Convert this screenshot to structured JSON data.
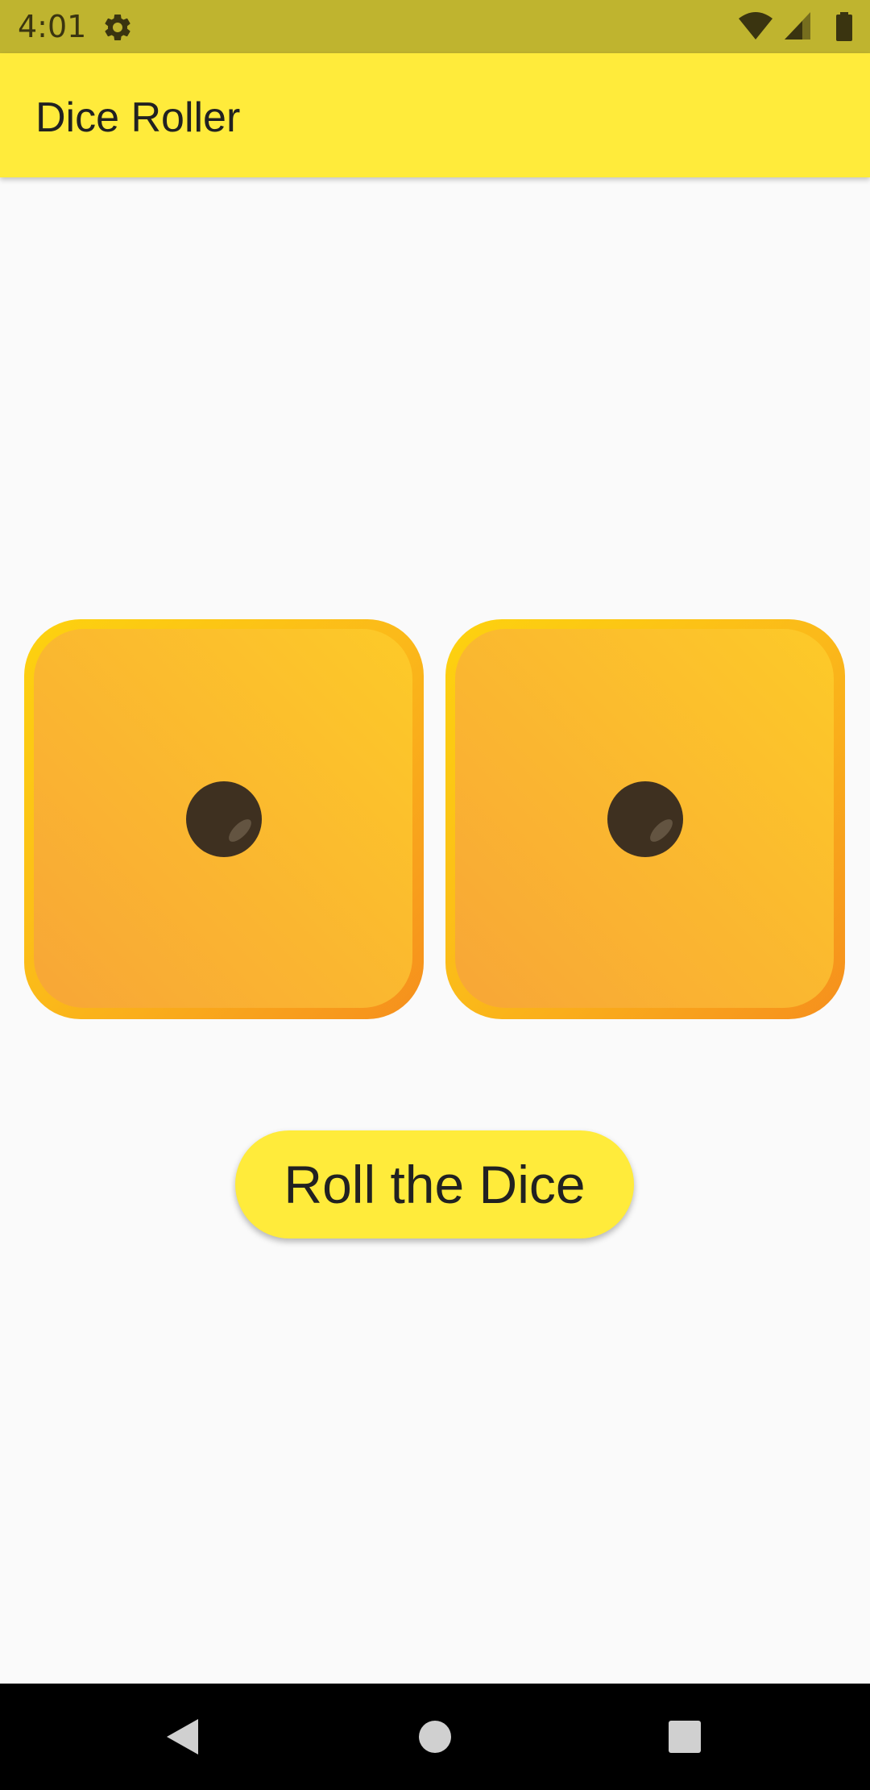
{
  "status_bar": {
    "time": "4:01",
    "icons": [
      "settings-gear-icon",
      "wifi-icon",
      "cell-signal-icon",
      "battery-icon"
    ]
  },
  "app_bar": {
    "title": "Dice Roller"
  },
  "dice": [
    {
      "value": 1
    },
    {
      "value": 1
    }
  ],
  "roll_button": {
    "label": "Roll the Dice"
  },
  "nav_bar": {
    "icons": [
      "back-icon",
      "home-icon",
      "recents-icon"
    ]
  },
  "colors": {
    "status_bar": "#bfb42f",
    "app_bar": "#ffeb3b",
    "background": "#fafafa",
    "dice_face": "#fbb829",
    "dice_pip": "#3e3020",
    "button": "#ffeb3b",
    "nav_bar": "#000000"
  }
}
